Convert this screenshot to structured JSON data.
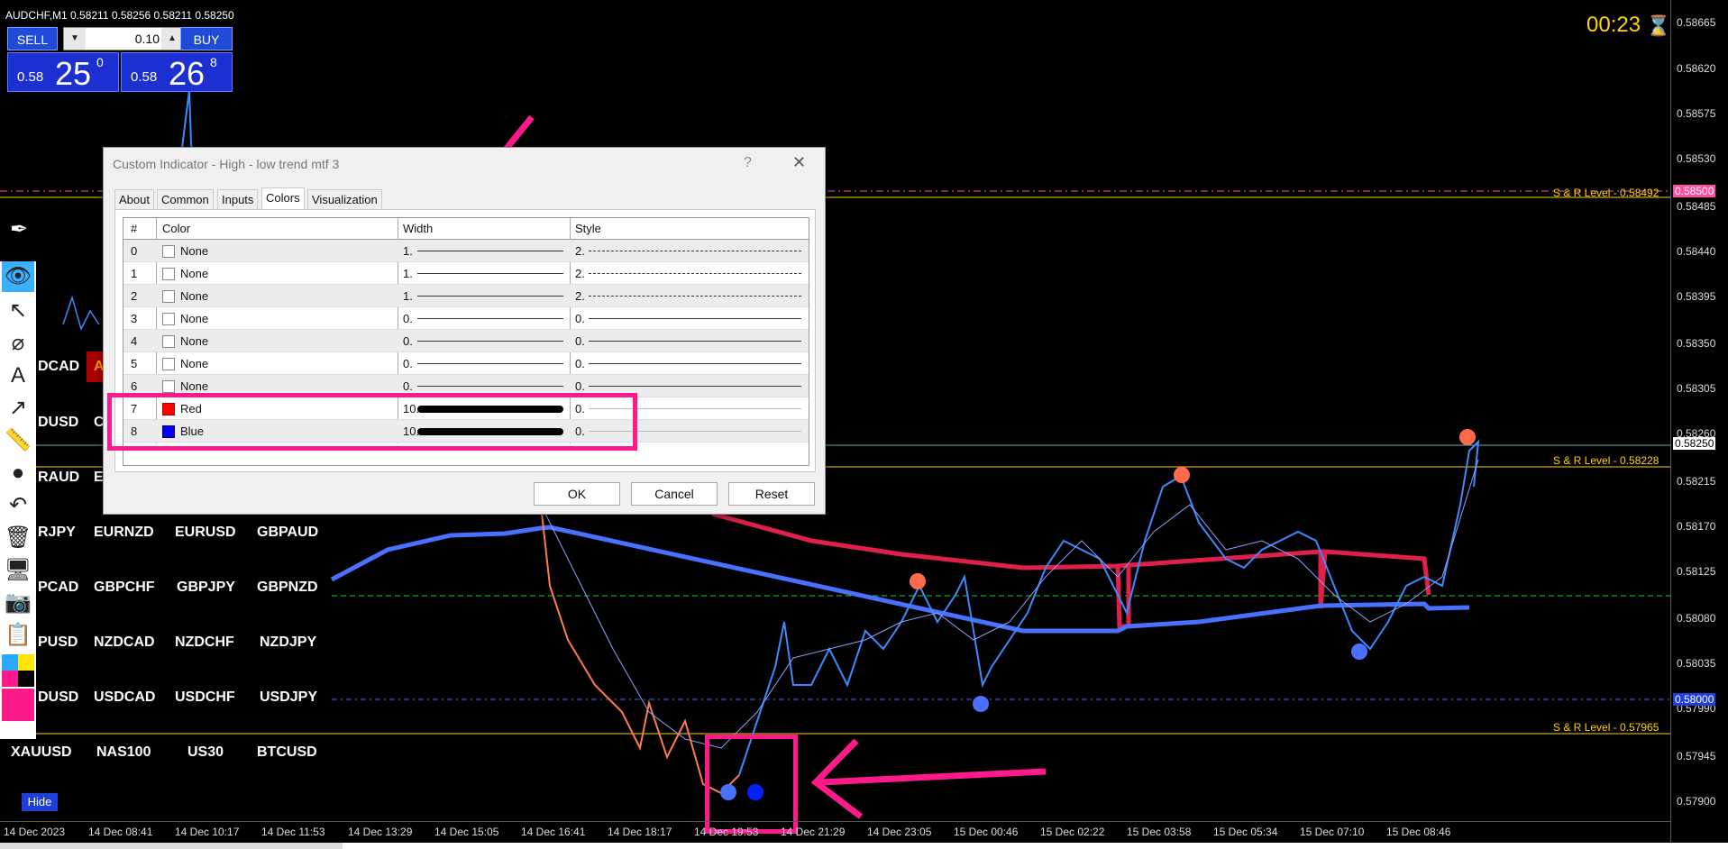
{
  "chart": {
    "symbol_line": "AUDCHF,M1  0.58211 0.58256 0.58211 0.58250",
    "countdown": "00:23",
    "hourglass_icon": "hourglass-icon"
  },
  "trade_panel": {
    "sell_label": "SELL",
    "buy_label": "BUY",
    "lot_value": "0.10",
    "sell_price": {
      "small": "0.58",
      "big": "25",
      "sup": "0"
    },
    "buy_price": {
      "small": "0.58",
      "big": "26",
      "sup": "8"
    }
  },
  "price_axis": {
    "ticks": [
      "0.58665",
      "0.58620",
      "0.58575",
      "0.58530",
      "0.58485",
      "0.58440",
      "0.58395",
      "0.58350",
      "0.58305",
      "0.58260",
      "0.58215",
      "0.58170",
      "0.58125",
      "0.58080",
      "0.58035",
      "0.57990",
      "0.57945",
      "0.57900"
    ],
    "tag_58500": "0.58500",
    "tag_58250": "0.58250",
    "tag_58000": "0.58000"
  },
  "sr_levels": {
    "top": "S & R  Level - 0.58492",
    "middle": "S & R  Level - 0.58228",
    "bottom": "S & R  Level - 0.57965"
  },
  "time_axis": [
    "14 Dec 2023",
    "14 Dec 08:41",
    "14 Dec 10:17",
    "14 Dec 11:53",
    "14 Dec 13:29",
    "14 Dec 15:05",
    "14 Dec 16:41",
    "14 Dec 18:17",
    "14 Dec 19:53",
    "14 Dec 21:29",
    "14 Dec 23:05",
    "15 Dec 00:46",
    "15 Dec 02:22",
    "15 Dec 03:58",
    "15 Dec 05:34",
    "15 Dec 07:10",
    "15 Dec 08:46"
  ],
  "pairs": {
    "row1": [
      "DCAD",
      "A"
    ],
    "row2": [
      "DUSD",
      "C"
    ],
    "row3": [
      "RAUD",
      "E"
    ],
    "row4": [
      "RJPY",
      "EURNZD",
      "EURUSD",
      "GBPAUD"
    ],
    "row5": [
      "PCAD",
      "GBPCHF",
      "GBPJPY",
      "GBPNZD"
    ],
    "row6": [
      "PUSD",
      "NZDCAD",
      "NZDCHF",
      "NZDJPY"
    ],
    "row7": [
      "DUSD",
      "USDCAD",
      "USDCHF",
      "USDJPY"
    ],
    "row8": [
      "XAUUSD",
      "NAS100",
      "US30",
      "BTCUSD"
    ]
  },
  "hide_label": "Hide",
  "dialog": {
    "title": "Custom Indicator - High - low trend mtf 3",
    "help": "?",
    "close": "✕",
    "tabs": [
      "About",
      "Common",
      "Inputs",
      "Colors",
      "Visualization"
    ],
    "columns": [
      "#",
      "Color",
      "Width",
      "Style"
    ],
    "rows": [
      {
        "index": "0",
        "color": "None",
        "width": "1.",
        "style": "2."
      },
      {
        "index": "1",
        "color": "None",
        "width": "1.",
        "style": "2."
      },
      {
        "index": "2",
        "color": "None",
        "width": "1.",
        "style": "2."
      },
      {
        "index": "3",
        "color": "None",
        "width": "0.",
        "style": "0."
      },
      {
        "index": "4",
        "color": "None",
        "width": "0.",
        "style": "0."
      },
      {
        "index": "5",
        "color": "None",
        "width": "0.",
        "style": "0."
      },
      {
        "index": "6",
        "color": "None",
        "width": "0.",
        "style": "0."
      },
      {
        "index": "7",
        "color": "Red",
        "width": "10.",
        "style": "0."
      },
      {
        "index": "8",
        "color": "Blue",
        "width": "10.",
        "style": "0."
      }
    ],
    "ok": "OK",
    "cancel": "Cancel",
    "reset": "Reset"
  },
  "colors": {
    "red": "#ff0000",
    "blue": "#0000ff",
    "highlight": "#ff1a8c",
    "sr_line": "#ffd400",
    "bull_candle": "#3b8bff",
    "bear_candle": "#ff7a4d"
  }
}
